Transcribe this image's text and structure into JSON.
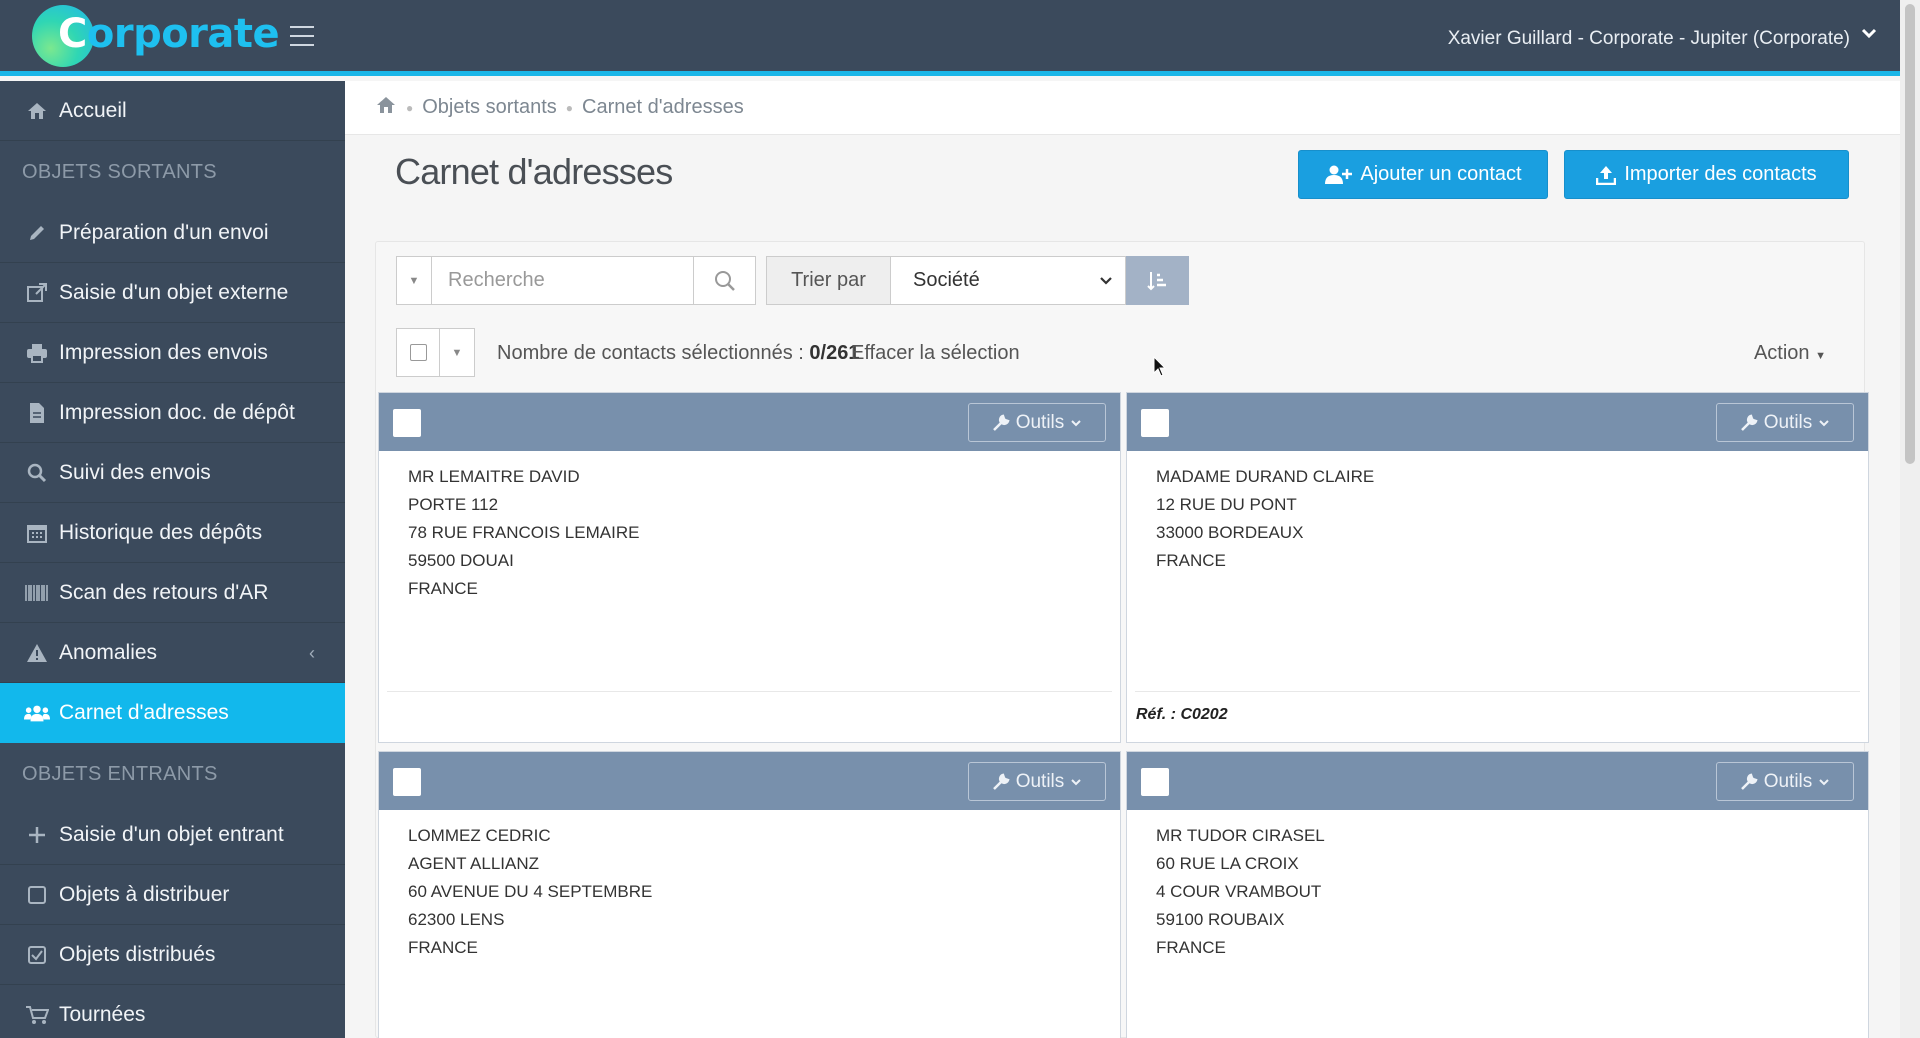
{
  "app": {
    "logo_text": "orporate",
    "logo_letter": "C"
  },
  "header": {
    "user": "Xavier Guillard - Corporate - Jupiter (Corporate)"
  },
  "sidebar": {
    "home": "Accueil",
    "section_outgoing": "OBJETS SORTANTS",
    "outgoing_items": [
      {
        "label": "Préparation d'un envoi",
        "icon": "pencil-icon"
      },
      {
        "label": "Saisie d'un objet externe",
        "icon": "external-link-icon"
      },
      {
        "label": "Impression des envois",
        "icon": "printer-icon"
      },
      {
        "label": "Impression doc. de dépôt",
        "icon": "document-icon"
      },
      {
        "label": "Suivi des envois",
        "icon": "search-icon"
      },
      {
        "label": "Historique des dépôts",
        "icon": "calendar-icon"
      },
      {
        "label": "Scan des retours d'AR",
        "icon": "barcode-icon"
      },
      {
        "label": "Anomalies",
        "icon": "warning-icon"
      },
      {
        "label": "Carnet d'adresses",
        "icon": "users-icon"
      }
    ],
    "section_incoming": "OBJETS ENTRANTS",
    "incoming_items": [
      {
        "label": "Saisie d'un objet entrant",
        "icon": "plus-icon"
      },
      {
        "label": "Objets à distribuer",
        "icon": "square-icon"
      },
      {
        "label": "Objets distribués",
        "icon": "checked-square-icon"
      },
      {
        "label": "Tournées",
        "icon": "cart-icon"
      }
    ]
  },
  "breadcrumb": {
    "level1": "Objets sortants",
    "level2": "Carnet d'adresses"
  },
  "page": {
    "title": "Carnet d'adresses",
    "add_contact": "Ajouter un contact",
    "import_contacts": "Importer des contacts"
  },
  "toolbar": {
    "search_placeholder": "Recherche",
    "sort_label": "Trier par",
    "sort_value": "Société"
  },
  "selection": {
    "count_label": "Nombre de contacts sélectionnés : ",
    "count_value": "0/261",
    "clear": "Effacer la sélection",
    "action": "Action"
  },
  "cards": [
    {
      "tools": "Outils",
      "lines": [
        "MR LEMAITRE DAVID",
        "PORTE 112",
        "78 RUE FRANCOIS LEMAIRE",
        "59500 DOUAI",
        "FRANCE"
      ],
      "ref": ""
    },
    {
      "tools": "Outils",
      "lines": [
        "MADAME DURAND CLAIRE",
        "12 RUE DU PONT",
        "33000 BORDEAUX",
        "FRANCE"
      ],
      "ref": "Réf. : C0202"
    },
    {
      "tools": "Outils",
      "lines": [
        "LOMMEZ CEDRIC",
        "AGENT ALLIANZ",
        "60 AVENUE DU 4 SEPTEMBRE",
        "62300 LENS",
        "FRANCE"
      ],
      "ref": ""
    },
    {
      "tools": "Outils",
      "lines": [
        "MR TUDOR CIRASEL",
        "60 RUE LA CROIX",
        "4 COUR VRAMBOUT",
        "59100 ROUBAIX",
        "FRANCE"
      ],
      "ref": ""
    }
  ],
  "colors": {
    "accent": "#12b8ec",
    "sidebar": "#3b4a5c",
    "card_header": "#7890ac",
    "primary_button": "#1a9fe0"
  }
}
